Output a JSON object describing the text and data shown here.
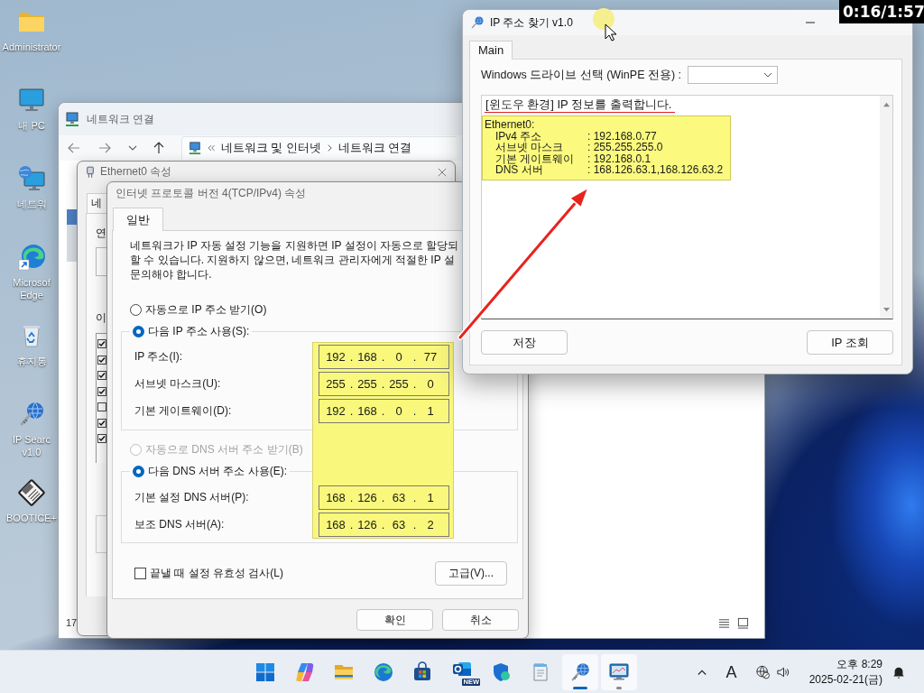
{
  "desktop": {
    "icons": [
      {
        "kind": "folder",
        "label": [
          "Administrator"
        ]
      },
      {
        "kind": "pc",
        "label": [
          "내 PC"
        ]
      },
      {
        "kind": "network",
        "label": [
          "네트워"
        ]
      },
      {
        "kind": "edge",
        "label": [
          "Microsof",
          "Edge"
        ]
      },
      {
        "kind": "recycle",
        "label": [
          "휴지통"
        ]
      },
      {
        "kind": "ipsearch",
        "label": [
          "IP Searc",
          "v1.0"
        ]
      },
      {
        "kind": "bootice",
        "label": [
          "BOOTICE+"
        ]
      }
    ]
  },
  "network_window": {
    "title": "네트워크 연결",
    "breadcrumb": [
      "네트워크 및 인터넷",
      "네트워크 연결"
    ],
    "status": "17"
  },
  "ethernet_window": {
    "title": "Ethernet0 속성",
    "tab": "네",
    "labels": [
      "연",
      "이"
    ],
    "components": [
      {
        "checked": true
      },
      {
        "checked": true
      },
      {
        "checked": true
      },
      {
        "checked": true
      },
      {
        "checked": false
      },
      {
        "checked": true
      },
      {
        "checked": true
      }
    ]
  },
  "tcp_dialog": {
    "title": "인터넷 프로토콜 버전 4(TCP/IPv4) 속성",
    "tabs": [
      {
        "label": "일반",
        "selected": true
      }
    ],
    "description": [
      "네트워크가 IP 자동 설정 기능을 지원하면 IP 설정이 자동으로 할당되",
      "할 수 있습니다. 지원하지 않으면, 네트워크 관리자에게 적절한 IP 설",
      "문의해야 합니다."
    ],
    "ip_options": [
      {
        "label": "자동으로 IP 주소 받기(O)",
        "selected": false,
        "disabled": false
      },
      {
        "label": "다음 IP 주소 사용(S):",
        "selected": true,
        "disabled": false
      }
    ],
    "ip_fields": [
      {
        "label": "IP 주소(I):",
        "value": "192 . 168 . 0 . 77"
      },
      {
        "label": "서브넷 마스크(U):",
        "value": "255 . 255 . 255 . 0"
      },
      {
        "label": "기본 게이트웨이(D):",
        "value": "192 . 168 . 0 . 1"
      }
    ],
    "dns_options": [
      {
        "label": "자동으로 DNS 서버 주소 받기(B)",
        "selected": false,
        "disabled": true
      },
      {
        "label": "다음 DNS 서버 주소 사용(E):",
        "selected": true,
        "disabled": false
      }
    ],
    "dns_fields": [
      {
        "label": "기본 설정 DNS 서버(P):",
        "value": "168 . 126 . 63 . 1"
      },
      {
        "label": "보조 DNS 서버(A):",
        "value": "168 . 126 . 63 . 2"
      }
    ],
    "validate": {
      "label": "끝낼 때 설정 유효성 검사(L)",
      "checked": false
    },
    "advanced_button": "고급(V)...",
    "buttons": [
      "확인",
      "취소"
    ]
  },
  "ip_window": {
    "title": "IP 주소 찾기 v1.0",
    "tabs": [
      {
        "label": "Main",
        "selected": true
      }
    ],
    "drive_label": "Windows 드라이브 선택 (WinPE 전용) :",
    "output": {
      "heading": "[윈도우 환경] IP 정보를 출력합니다.",
      "adapter": "Ethernet0:",
      "rows": [
        {
          "key": "IPv4 주소",
          "value": ": 192.168.0.77"
        },
        {
          "key": "서브넷 마스크",
          "value": ": 255.255.255.0"
        },
        {
          "key": "기본 게이트웨이",
          "value": ": 192.168.0.1"
        },
        {
          "key": "DNS 서버",
          "value": ": 168.126.63.1,168.126.63.2"
        }
      ]
    },
    "buttons": [
      "저장",
      "IP 조회"
    ]
  },
  "video_timer": "0:16/1:57",
  "taskbar": {
    "apps": [
      {
        "kind": "start",
        "running": false,
        "selected": false
      },
      {
        "kind": "copilot",
        "running": false,
        "selected": false
      },
      {
        "kind": "explorer",
        "running": false,
        "selected": false
      },
      {
        "kind": "edge",
        "running": false,
        "selected": false
      },
      {
        "kind": "store",
        "running": false,
        "selected": false
      },
      {
        "kind": "outlook",
        "badge": "NEW",
        "running": false,
        "selected": false
      },
      {
        "kind": "defender",
        "running": false,
        "selected": false
      },
      {
        "kind": "notepad",
        "running": false,
        "selected": false
      },
      {
        "kind": "ipsearch",
        "running": true,
        "selected": true
      },
      {
        "kind": "viewer",
        "running": true,
        "selected": false
      }
    ],
    "ime": "A",
    "time": "오후 8:29",
    "date": "2025-02-21(금)"
  }
}
